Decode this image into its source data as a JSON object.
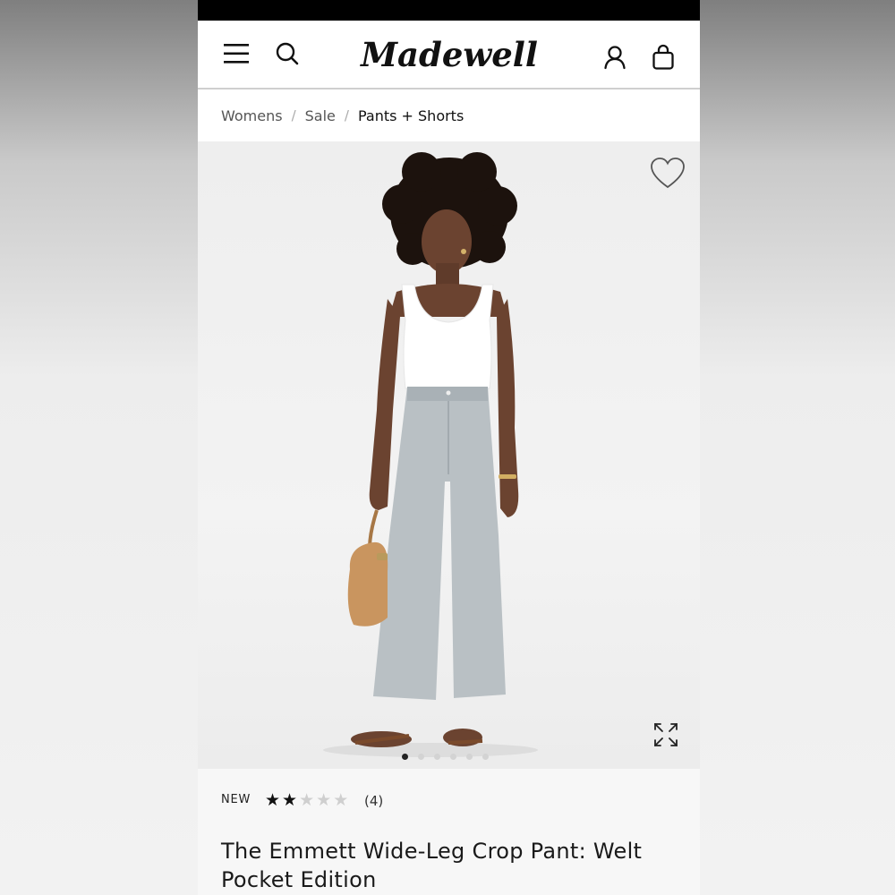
{
  "brand": {
    "logo_text": "Madewell"
  },
  "header": {
    "icons": [
      "menu-icon",
      "search-icon",
      "account-icon",
      "bag-icon"
    ]
  },
  "breadcrumb": [
    "Womens",
    "Sale",
    "Pants + Shorts"
  ],
  "gallery": {
    "image_count": 6,
    "active_index": 0
  },
  "product": {
    "badge": "NEW",
    "rating": 2,
    "rating_max": 5,
    "review_count": "(4)",
    "title": "The Emmett Wide-Leg Crop Pant: Welt Pocket Edition"
  },
  "colors": {
    "accent": "#111111",
    "star_empty": "#cfcfcf",
    "skin": "#6b4330",
    "pants": "#b9c0c4",
    "bag": "#c9955f"
  }
}
